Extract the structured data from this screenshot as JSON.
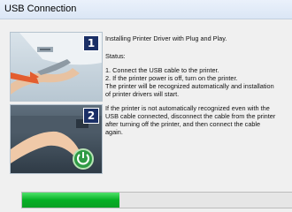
{
  "window": {
    "title": "USB Connection"
  },
  "panels": [
    {
      "step": "1",
      "illustration": "usb-cable-plug"
    },
    {
      "step": "2",
      "illustration": "power-button"
    }
  ],
  "instructions": {
    "heading": "Installing Printer Driver with Plug and Play.",
    "status_label": "Status:",
    "steps": [
      "1. Connect the USB cable to the printer.",
      "2. If the printer power is off, turn on the printer.",
      "The printer will be recognized automatically and installation",
      "of printer drivers will start."
    ],
    "note": [
      "If the printer is not automatically recognized even with the",
      "USB cable connected, disconnect the cable from the printer",
      "after turning off the printer, and then connect the cable",
      "again."
    ]
  },
  "progress": {
    "fraction": 0.36,
    "color": "#06b025"
  }
}
